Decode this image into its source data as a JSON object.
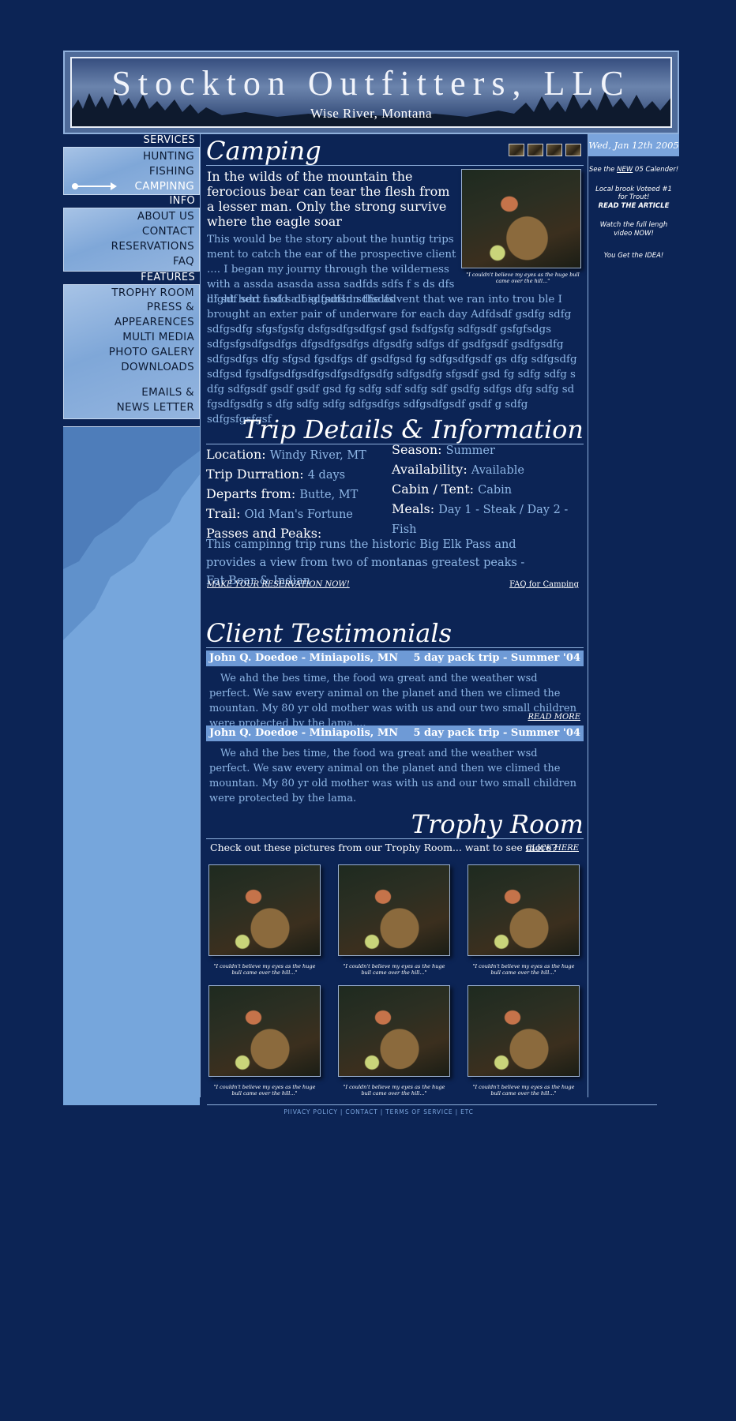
{
  "header": {
    "title": "Stockton Outfitters, LLC",
    "subtitle": "Wise River, Montana"
  },
  "nav": {
    "services_heading": "SERVICES",
    "services": [
      "HUNTING",
      "FISHING",
      "CAMPINNG"
    ],
    "active": "CAMPINNG",
    "info_heading": "INFO",
    "info": [
      "ABOUT US",
      "CONTACT",
      "RESERVATIONS",
      "FAQ"
    ],
    "features_heading": "FEATURES",
    "features": [
      "TROPHY ROOM",
      "PRESS &",
      "APPEARENCES",
      "MULTI MEDIA",
      "PHOTO GALERY",
      "DOWNLOADS"
    ],
    "emails_line1": "EMAILS &",
    "emails_line2": "NEWS LETTER"
  },
  "camping": {
    "title": "Camping",
    "lead": "In the wilds of the mountain the ferocious bear can tear the flesh from a lesser man. Only the strong survive where the eagle soar",
    "body_wrap": "This would be the story about the huntig trips ment to catch the ear of the prospective client .... I began  my journy through the wilderness with a assda asasda assa sadfds sdfs f s ds dfs df sdf sdd f sd s df sdfsdfsd sdfsdfs",
    "body_full": "lilght hert anfd a big gunInn the advent that we ran into trou ble I brought an exter pair of underware for each day Adfdsdf gsdfg sdfg sdfgsdfg sfgsfgsfg dsfgsdfgsdfgsf gsd fsdfgsfg sdfgsdf gsfgfsdgs sdfgsfgsdfgsdfgs dfgsdfgsdfgs dfgsdfg sdfgs df gsdfgsdf gsdfgsdfg sdfgsdfgs dfg sfgsd fgsdfgs df  gsdfgsd fg  sdfgsdfgsdf gs dfg sdfgsdfg sdfgsd fgsdfgsdfgsdfgsdfgsdfgsdfg sdfgsdfg sfgsdf  gsd fg   sdfg sdfg s dfg sdfgsdf gsdf gsdf  gsd fg sdfg sdf sdfg sdf gsdfg  sdfgs dfg sdfg sd fgsdfgsdfg s dfg sdfg sdfg sdfgsdfgs sdfgsdfgsdf gsdf g  sdfg sdfgsfgsfgsf",
    "photo_caption": "\"I couldn't believe my eyes as the  huge bull came over the hill...\""
  },
  "trip": {
    "title": "Trip Details & Information",
    "location_label": "Location:",
    "location": "Windy River, MT",
    "duration_label": "Trip Durration:",
    "duration": "4 days",
    "departs_label": "Departs from:",
    "departs": "Butte, MT",
    "trail_label": "Trail:",
    "trail": "Old Man's Fortune",
    "season_label": "Season:",
    "season": "Summer",
    "availability_label": "Availability:",
    "availability": "Available",
    "cabin_label": "Cabin / Tent:",
    "cabin": "Cabin",
    "meals_label": "Meals:",
    "meals": "Day 1 - Steak / Day 2 - Fish",
    "passes_label": "Passes and Peaks:",
    "passes_text": "This campinng trip runs the historic Big Elk Pass and provides a view from two of montanas greatest peaks - Fat Bear & Indian",
    "reserve_link": "MAKE YOUR RESERVATION NOW!",
    "faq_link": "FAQ for Camping"
  },
  "testimonials": {
    "title": "Client Testimonials",
    "items": [
      {
        "name": "John Q. Doedoe - Miniapolis, MN",
        "trip": "5 day pack trip - Summer '04",
        "text": "We ahd the bes time, the food wa great and the weather wsd perfect.  We saw every animal on the planet and then we climed the mountan.  My 80 yr old mother was with us and our two small children were protected by the lama....",
        "more": "READ MORE"
      },
      {
        "name": "John Q. Doedoe - Miniapolis, MN",
        "trip": "5 day pack trip - Summer '04",
        "text": "We ahd the bes time, the food wa great and the weather wsd perfect.  We saw every animal on the planet and then we climed the mountan.  My 80 yr old mother was with us and our two small children were protected by the lama."
      }
    ]
  },
  "trophy": {
    "title": "Trophy Room",
    "intro": "Check out these pictures from our Trophy Room... want to see more?",
    "click_here": "CLICK HERE",
    "captions": [
      "\"I couldn't believe my eyes as the  huge bull came over the hill...\"",
      "\"I couldn't believe my eyes as the  huge bull came over the hill...\"",
      "\"I couldn't believe my eyes as the  huge bull came over the hill...\"",
      "\"I couldn't believe my eyes as the  huge bull came over the hill...\"",
      "\"I couldn't believe my eyes as the  huge bull came over the hill...\"",
      "\"I couldn't believe my eyes as the  huge bull came over the hill...\""
    ]
  },
  "sidebar": {
    "date": "Wed, Jan 12th 2005",
    "note1_pre": "See the ",
    "note1_new": "NEW",
    "note1_post": " 05 Calender!",
    "note2_line1": "Local brook Voteed #1",
    "note2_line2": "for Trout!",
    "note2_line3": "READ THE ARTICLE",
    "note3_line1": "Watch the full lengh",
    "note3_line2": "video NOW!",
    "note4": "You Get the IDEA!"
  },
  "footer": {
    "text": "PIIVACY POLICY  |  CONTACT  |  TERMS OF SERVICE  |  ETC"
  },
  "colors": {
    "background": "#0c2455",
    "accent_light": "#7aa4dc",
    "body_text": "#8fb7e6"
  }
}
